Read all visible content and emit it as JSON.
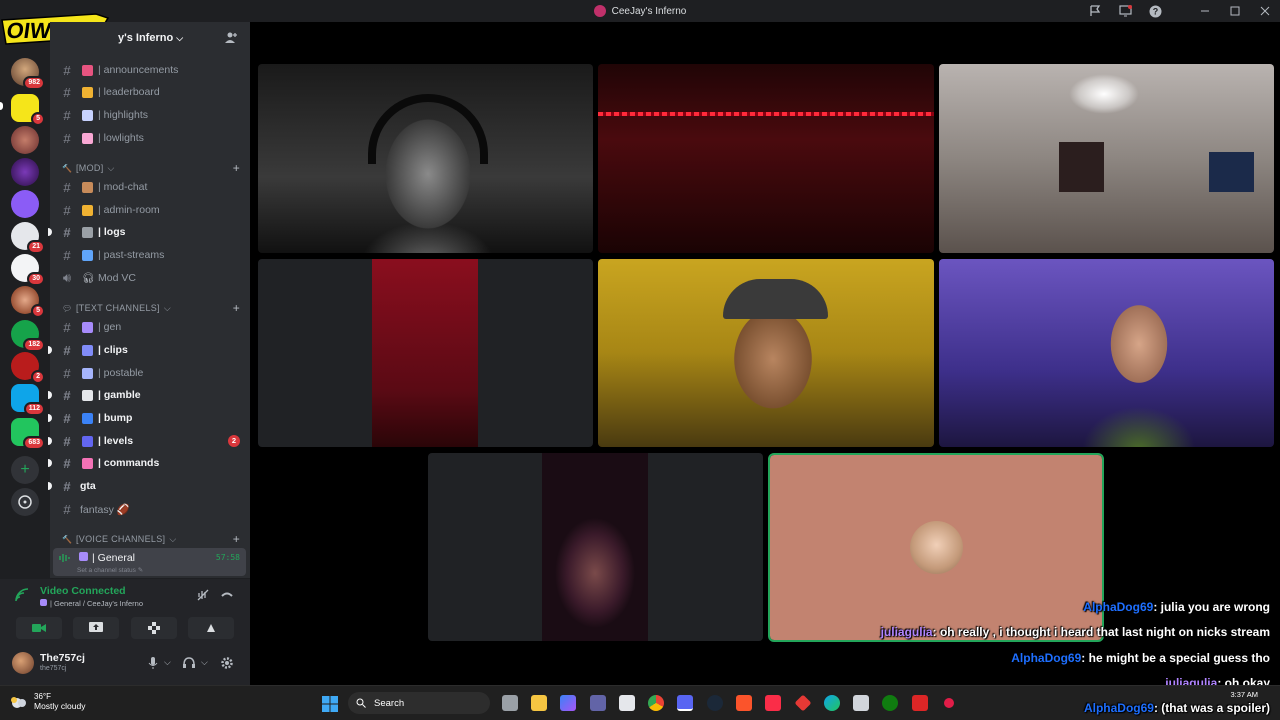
{
  "window": {
    "title": "CeeJay's Inferno"
  },
  "server": {
    "name": "CeeJay's Inferno",
    "name_visible": "y's Inferno",
    "rail_badges": [
      "982",
      "5",
      "21",
      "30",
      "5",
      "182",
      "2",
      "112",
      "683"
    ]
  },
  "channels": {
    "top": [
      {
        "name": "announcements",
        "emoji_color": "#e75480"
      },
      {
        "name": "leaderboard",
        "emoji_color": "#f0b232"
      },
      {
        "name": "highlights",
        "emoji_color": "#c7d2fe"
      },
      {
        "name": "lowlights",
        "emoji_color": "#f9a8d4"
      }
    ],
    "mod_category": "[MOD]",
    "mod": [
      {
        "name": "mod-chat",
        "emoji_color": "#c78b5a",
        "unread": false
      },
      {
        "name": "admin-room",
        "emoji_color": "#f0b232",
        "unread": false
      },
      {
        "name": "logs",
        "emoji_color": "#9aa0a6",
        "unread": true
      },
      {
        "name": "past-streams",
        "emoji_color": "#60a5fa",
        "unread": false
      },
      {
        "name": "Mod VC",
        "emoji_color": "#9aa0a6",
        "unread": false
      }
    ],
    "text_category": "[TEXT CHANNELS]",
    "text": [
      {
        "name": "gen",
        "emoji_color": "#a78bfa",
        "unread": false
      },
      {
        "name": "clips",
        "emoji_color": "#818cf8",
        "unread": true
      },
      {
        "name": "postable",
        "emoji_color": "#a5b4fc",
        "unread": false
      },
      {
        "name": "gamble",
        "emoji_color": "#e5e7eb",
        "unread": true
      },
      {
        "name": "bump",
        "emoji_color": "#3b82f6",
        "unread": true
      },
      {
        "name": "levels",
        "emoji_color": "#6366f1",
        "unread": true,
        "mentions": "2"
      },
      {
        "name": "commands",
        "emoji_color": "#f472b6",
        "unread": true
      },
      {
        "name": "gta",
        "emoji_color": "",
        "unread": true
      },
      {
        "name": "fantasy 🏈",
        "emoji_color": "",
        "unread": false
      }
    ],
    "voice_category": "[VOICE CHANNELS]",
    "voice_active": {
      "name": "General",
      "timer": "57:58",
      "status": "Set a channel status"
    }
  },
  "voice_panel": {
    "title": "Video Connected",
    "subtitle": "General / CeeJay's Inferno"
  },
  "user": {
    "name": "The757cj",
    "tag": "the757cj"
  },
  "chat": [
    {
      "user": "AlphaDog69",
      "text": ": julia you are wrong",
      "color": "u1"
    },
    {
      "user": "juliagulia",
      "text": ": oh really , i thought i heard that last night on nicks stream",
      "color": "u2"
    },
    {
      "user": "AlphaDog69",
      "text": ": he might be a special guess tho",
      "color": "u1"
    },
    {
      "user": "juliagulia",
      "text": ": oh okay",
      "color": "u2"
    },
    {
      "user": "AlphaDog69",
      "text": ": (that was a spoiler)",
      "color": "u1"
    }
  ],
  "taskbar": {
    "temp": "36°F",
    "weather": "Mostly cloudy",
    "search_placeholder": "Search",
    "time": "3:37 AM"
  }
}
